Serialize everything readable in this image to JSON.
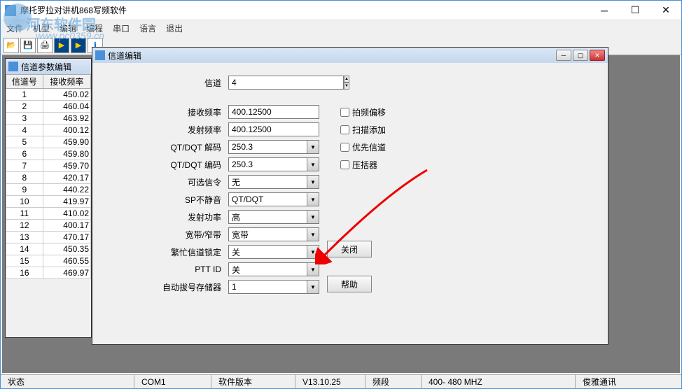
{
  "app": {
    "title": "摩托罗拉对讲机868写频软件",
    "watermark_text": "河东软件园",
    "watermark_url": "www.pc0359.cn"
  },
  "menu": [
    "文件",
    "机型",
    "编辑",
    "编程",
    "串口",
    "语言",
    "退出"
  ],
  "child_list": {
    "title": "信道参数编辑",
    "headers": [
      "信道号",
      "接收频率"
    ],
    "rows": [
      [
        "1",
        "450.02"
      ],
      [
        "2",
        "460.04"
      ],
      [
        "3",
        "463.92"
      ],
      [
        "4",
        "400.12"
      ],
      [
        "5",
        "459.90"
      ],
      [
        "6",
        "459.80"
      ],
      [
        "7",
        "459.70"
      ],
      [
        "8",
        "420.17"
      ],
      [
        "9",
        "440.22"
      ],
      [
        "10",
        "419.97"
      ],
      [
        "11",
        "410.02"
      ],
      [
        "12",
        "400.17"
      ],
      [
        "13",
        "470.17"
      ],
      [
        "14",
        "450.35"
      ],
      [
        "15",
        "460.55"
      ],
      [
        "16",
        "469.97"
      ]
    ]
  },
  "dialog": {
    "title": "信道编辑",
    "channel_label": "信道",
    "channel_value": "4",
    "fields": {
      "rx_freq": {
        "label": "接收频率",
        "value": "400.12500"
      },
      "tx_freq": {
        "label": "发射频率",
        "value": "400.12500"
      },
      "qt_decode": {
        "label": "QT/DQT 解码",
        "value": "250.3"
      },
      "qt_encode": {
        "label": "QT/DQT 编码",
        "value": "250.3"
      },
      "opt_signal": {
        "label": "可选信令",
        "value": "无"
      },
      "sp_mute": {
        "label": "SP不静音",
        "value": "QT/DQT"
      },
      "tx_power": {
        "label": "发射功率",
        "value": "高"
      },
      "bandwidth": {
        "label": "宽带/窄带",
        "value": "宽带"
      },
      "busy_lock": {
        "label": "繁忙信道锁定",
        "value": "关"
      },
      "ptt_id": {
        "label": "PTT ID",
        "value": "关"
      },
      "auto_dial": {
        "label": "自动拔号存储器",
        "value": "1"
      }
    },
    "checkboxes": {
      "freq_offset": "拍频偏移",
      "scan_add": "扫描添加",
      "priority": "优先信道",
      "compressor": "压括器"
    },
    "buttons": {
      "close": "关闭",
      "help": "帮助"
    }
  },
  "status": {
    "state": "状态",
    "com": "COM1",
    "version_label": "软件版本",
    "version": "V13.10.25",
    "band_label": "频段",
    "band": "400- 480 MHZ",
    "company": "俊雅通讯"
  }
}
